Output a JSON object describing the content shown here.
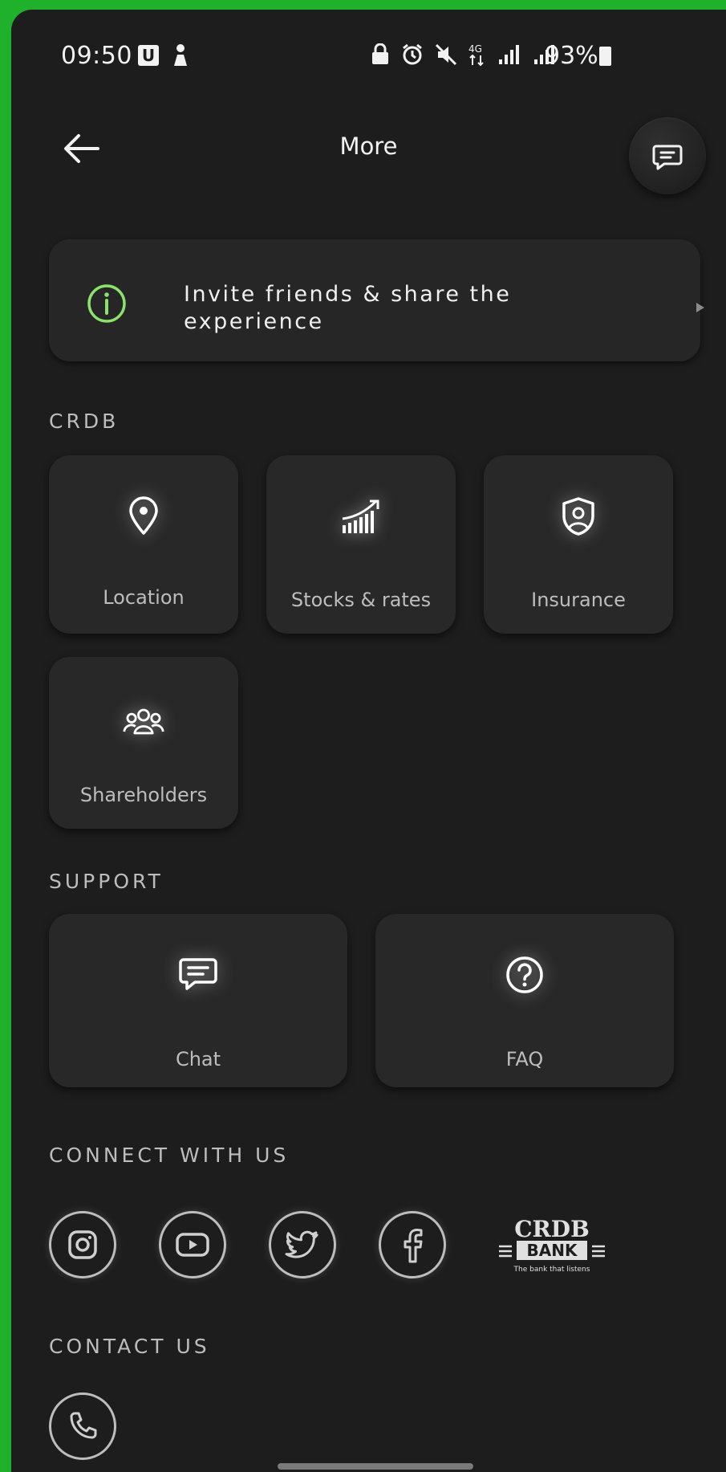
{
  "status_bar": {
    "time": "09:50",
    "u_badge": "U",
    "battery": "93%",
    "icons": [
      "lock-icon",
      "alarm-icon",
      "mute-icon",
      "4g-icon",
      "signal-icon",
      "signal-icon",
      "battery-icon"
    ]
  },
  "header": {
    "title": "More",
    "back_icon": "arrow-left-icon",
    "chat_icon": "message-icon"
  },
  "invite": {
    "text": "Invite friends & share the experience",
    "icon": "info-icon",
    "accent": "#8be36b"
  },
  "sections": {
    "crdb": {
      "title": "CRDB",
      "tiles": [
        {
          "label": "Location",
          "icon": "location-pin-icon"
        },
        {
          "label": "Stocks & rates",
          "icon": "chart-growth-icon"
        },
        {
          "label": "Insurance",
          "icon": "shield-user-icon"
        },
        {
          "label": "Shareholders",
          "icon": "group-icon"
        }
      ]
    },
    "support": {
      "title": "SUPPORT",
      "tiles": [
        {
          "label": "Chat",
          "icon": "chat-icon"
        },
        {
          "label": "FAQ",
          "icon": "question-icon"
        }
      ]
    },
    "connect": {
      "title": "CONNECT WITH US",
      "links": [
        "instagram-icon",
        "youtube-icon",
        "twitter-icon",
        "facebook-icon"
      ],
      "logo": {
        "top": "CRDB",
        "middle": "BANK",
        "tagline": "The bank that listens"
      }
    },
    "contact": {
      "title": "CONTACT US",
      "icon": "phone-icon"
    }
  },
  "colors": {
    "background": "#1d1d1d",
    "card": "#282828",
    "text": "#bdbdbd",
    "outer": "#1fb02c"
  }
}
